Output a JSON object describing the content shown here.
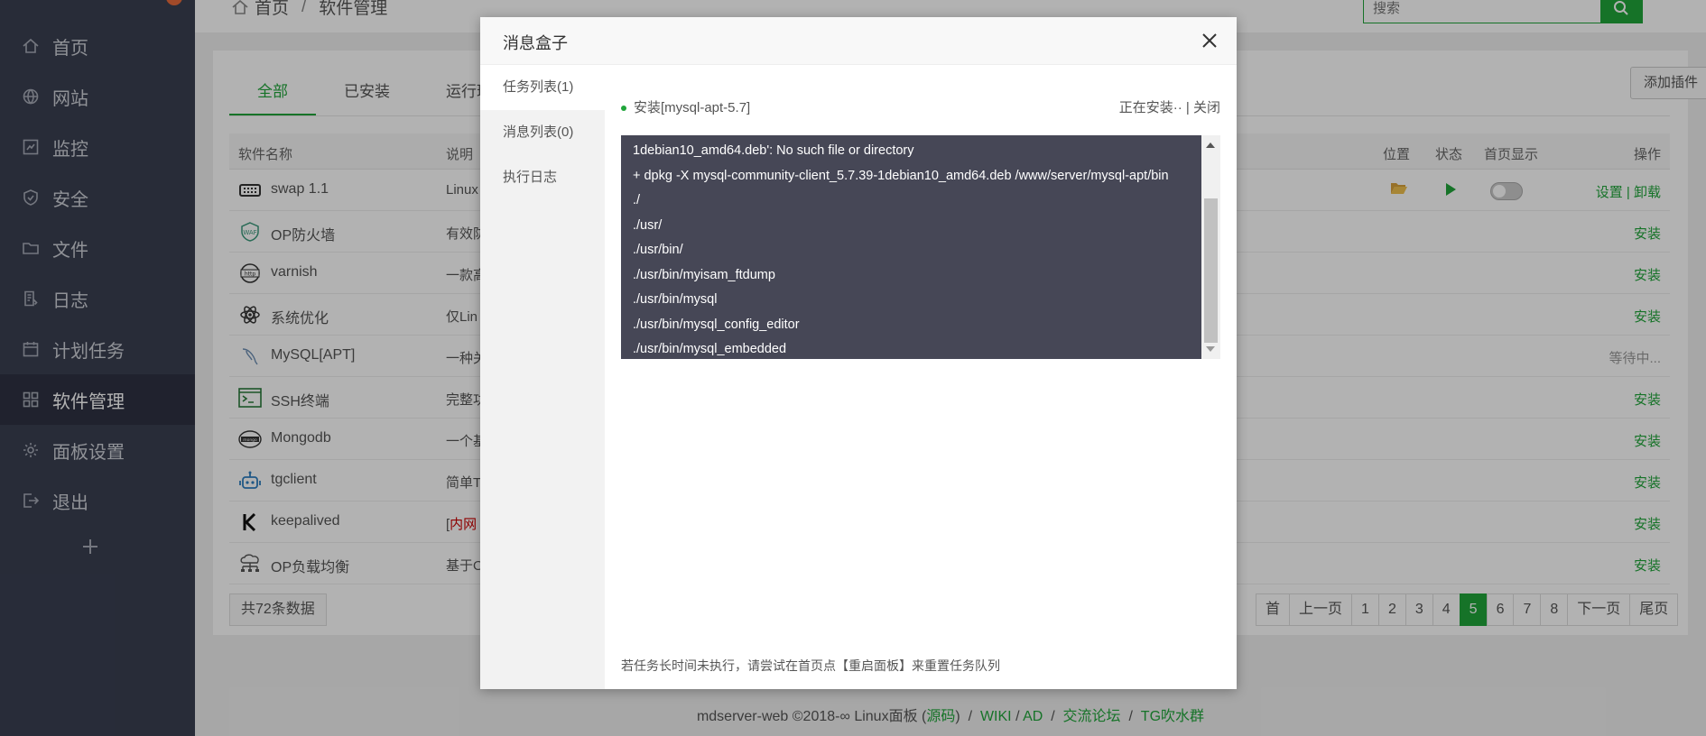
{
  "sidebar": {
    "items": [
      {
        "label": "首页",
        "icon": "home-icon"
      },
      {
        "label": "网站",
        "icon": "globe-icon"
      },
      {
        "label": "监控",
        "icon": "monitor-icon"
      },
      {
        "label": "安全",
        "icon": "shield-icon"
      },
      {
        "label": "文件",
        "icon": "folder-icon"
      },
      {
        "label": "日志",
        "icon": "log-icon"
      },
      {
        "label": "计划任务",
        "icon": "calendar-icon"
      },
      {
        "label": "软件管理",
        "icon": "apps-icon"
      },
      {
        "label": "面板设置",
        "icon": "gear-icon"
      },
      {
        "label": "退出",
        "icon": "logout-icon"
      }
    ]
  },
  "breadcrumb": {
    "home": "首页",
    "sep": "/",
    "current": "软件管理"
  },
  "search": {
    "placeholder": "搜索"
  },
  "tabs": [
    "全部",
    "已安装",
    "运行环"
  ],
  "add_plugin": "添加插件",
  "table": {
    "headers": {
      "name": "软件名称",
      "desc": "说明",
      "location": "位置",
      "status": "状态",
      "home_show": "首页显示",
      "action": "操作"
    },
    "rows": [
      {
        "name": "swap 1.1",
        "desc": "Linux",
        "action_a": "设置",
        "action_sep": "|",
        "action_b": "卸载"
      },
      {
        "name": "OP防火墙",
        "desc": "有效防",
        "action": "安装"
      },
      {
        "name": "varnish",
        "desc": "一款高",
        "action": "安装"
      },
      {
        "name": "系统优化",
        "desc": "仅Lin",
        "action": "安装"
      },
      {
        "name": "MySQL[APT]",
        "desc": "一种关",
        "action": "等待中..."
      },
      {
        "name": "SSH终端",
        "desc": "完整功",
        "action": "安装"
      },
      {
        "name": "Mongodb",
        "desc": "一个基",
        "action": "安装"
      },
      {
        "name": "tgclient",
        "desc": "简单T",
        "action": "安装"
      },
      {
        "name": "keepalived",
        "desc_pre": "[",
        "desc_red": "内网",
        "action": "安装"
      },
      {
        "name": "OP负载均衡",
        "desc": "基于O",
        "action": "安装"
      }
    ]
  },
  "total": "共72条数据",
  "pager": [
    "首",
    "上一页",
    "1",
    "2",
    "3",
    "4",
    "5",
    "6",
    "7",
    "8",
    "下一页",
    "尾页"
  ],
  "pager_current": "5",
  "footer": {
    "prefix": "mdserver-web ©2018-∞ Linux面板 (",
    "source": "源码",
    "suffix": ")",
    "sep": "/",
    "wiki": "WIKI",
    "ad": "AD",
    "forum": "交流论坛",
    "tg": "TG吹水群"
  },
  "modal": {
    "title": "消息盒子",
    "tabs": [
      "任务列表(1)",
      "消息列表(0)",
      "执行日志"
    ],
    "task_name": "安装[mysql-apt-5.7]",
    "task_status": "正在安装··",
    "task_sep": "|",
    "task_close": "关闭",
    "console_lines": [
      "1debian10_amd64.deb': No such file or directory",
      "+ dpkg -X mysql-community-client_5.7.39-1debian10_amd64.deb /www/server/mysql-apt/bin",
      "./",
      "./usr/",
      "./usr/bin/",
      "./usr/bin/myisam_ftdump",
      "./usr/bin/mysql",
      "./usr/bin/mysql_config_editor",
      "./usr/bin/mysql_embedded"
    ],
    "hint": "若任务长时间未执行，请尝试在首页点【重启面板】来重置任务队列"
  },
  "colors": {
    "accent": "#20a53a",
    "sidebar": "#3a3f51",
    "console": "#464756"
  }
}
